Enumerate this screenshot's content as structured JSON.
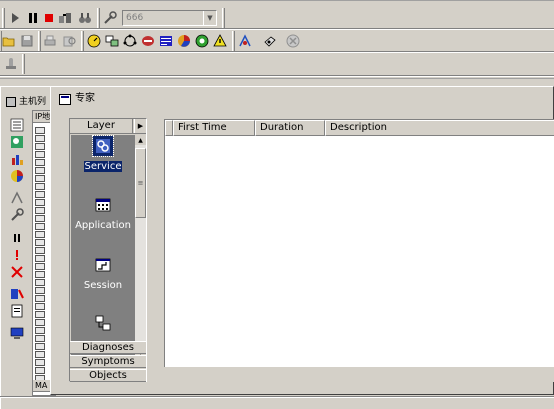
{
  "toolbar": {
    "combo_value": "666",
    "combo_arrow": "▼"
  },
  "host_window": {
    "title": "主机列",
    "list_header": "IP地",
    "tab": "MA"
  },
  "expert_window": {
    "title": "专家",
    "layer_panel": {
      "header": "Layer",
      "header_arrow": "▶",
      "items": [
        {
          "label": "Service",
          "icon": "service-icon",
          "selected": true
        },
        {
          "label": "Application",
          "icon": "application-icon",
          "selected": false
        },
        {
          "label": "Session",
          "icon": "session-icon",
          "selected": false
        },
        {
          "label": "",
          "icon": "network-icon",
          "selected": false
        }
      ],
      "scroll_up": "▲",
      "scroll_down": "▼",
      "scroll_grip": "≡"
    },
    "sections": [
      "Diagnoses",
      "Symptoms",
      "Objects"
    ],
    "table": {
      "columns": [
        "",
        "First Time",
        "Duration",
        "Description"
      ]
    }
  },
  "colors": {
    "selection": "#0a246a",
    "panel_bg": "#808080",
    "face": "#d4d0c8"
  }
}
